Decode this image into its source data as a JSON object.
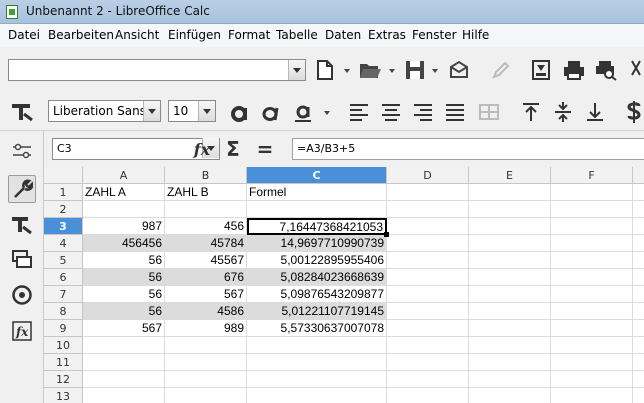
{
  "window": {
    "title": "Unbenannt 2 - LibreOffice Calc"
  },
  "menu": [
    "Datei",
    "Bearbeiten",
    "Ansicht",
    "Einfügen",
    "Format",
    "Tabelle",
    "Daten",
    "Extras",
    "Fenster",
    "Hilfe"
  ],
  "toolbar": {
    "font_name": "Liberation Sans",
    "font_size": "10",
    "accent": "#4a90d9"
  },
  "formula_bar": {
    "cell_ref": "C3",
    "formula": "=A3/B3+5",
    "function_symbol": "fx",
    "sum_symbol": "Σ",
    "equals_symbol": "="
  },
  "sheet": {
    "columns": [
      "A",
      "B",
      "C",
      "D",
      "E",
      "F"
    ],
    "rows": [
      "1",
      "2",
      "3",
      "4",
      "5",
      "6",
      "7",
      "8",
      "9",
      "10",
      "11",
      "12",
      "13"
    ],
    "headers": [
      "ZAHL A",
      "ZAHL B",
      "Formel"
    ],
    "data": [
      [
        "987",
        "456",
        "7,16447368421053"
      ],
      [
        "456456",
        "45784",
        "14,9697710990739"
      ],
      [
        "56",
        "45567",
        "5,00122895955406"
      ],
      [
        "56",
        "676",
        "5,08284023668639"
      ],
      [
        "56",
        "567",
        "5,09876543209877"
      ],
      [
        "56",
        "4586",
        "5,01221107719145"
      ],
      [
        "567",
        "989",
        "5,57330637007078"
      ]
    ]
  }
}
